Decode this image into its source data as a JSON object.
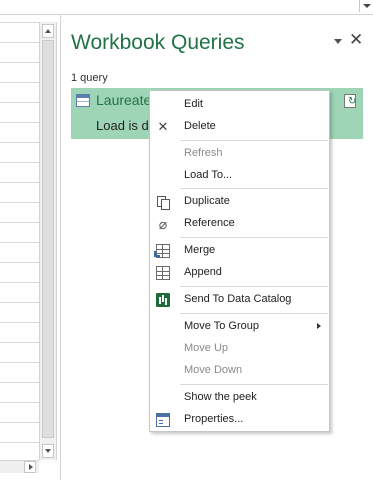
{
  "pane": {
    "title": "Workbook Queries",
    "close_glyph": "✕",
    "query_count": "1 query"
  },
  "query": {
    "name": "Laureate",
    "status": "Load is d"
  },
  "menu": {
    "items": [
      {
        "label": "Edit",
        "icon": "",
        "enabled": true
      },
      {
        "label": "Delete",
        "icon": "close-icon",
        "enabled": true
      },
      {
        "label": "Refresh",
        "icon": "",
        "enabled": false
      },
      {
        "label": "Load To...",
        "icon": "",
        "enabled": true
      },
      {
        "label": "Duplicate",
        "icon": "duplicate-icon",
        "enabled": true
      },
      {
        "label": "Reference",
        "icon": "paperclip-icon",
        "enabled": true
      },
      {
        "label": "Merge",
        "icon": "merge-icon",
        "enabled": true
      },
      {
        "label": "Append",
        "icon": "append-icon",
        "enabled": true
      },
      {
        "label": "Send To Data Catalog",
        "icon": "data-catalog-icon",
        "enabled": true
      },
      {
        "label": "Move To Group",
        "icon": "",
        "enabled": true,
        "submenu": true
      },
      {
        "label": "Move Up",
        "icon": "",
        "enabled": false
      },
      {
        "label": "Move Down",
        "icon": "",
        "enabled": false
      },
      {
        "label": "Show the peek",
        "icon": "",
        "enabled": true
      },
      {
        "label": "Properties...",
        "icon": "properties-icon",
        "enabled": true
      }
    ]
  },
  "colors": {
    "accent": "#217346",
    "query_highlight": "#9fd5b7",
    "disabled_text": "#8a8a8a"
  }
}
